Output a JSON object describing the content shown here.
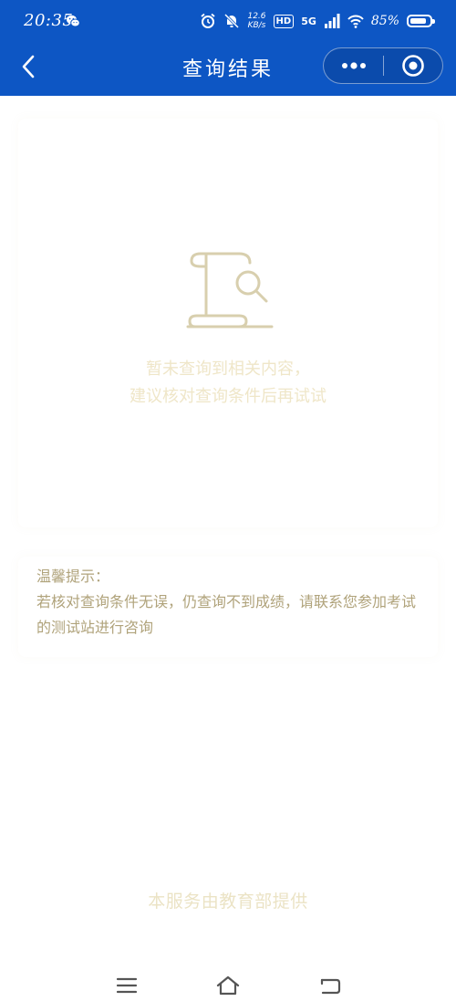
{
  "status_bar": {
    "time": "20:35",
    "net_speed_value": "12.6",
    "net_speed_unit": "KB/s",
    "hd_label": "HD",
    "network_label": "5G",
    "battery_text": "85%",
    "battery_level": 0.85
  },
  "nav": {
    "title": "查询结果"
  },
  "result": {
    "empty_line1": "暂未查询到相关内容，",
    "empty_line2": "建议核对查询条件后再试试"
  },
  "tips": {
    "title": "温馨提示：",
    "body": "若核对查询条件无误，仍查询不到成绩，请联系您参加考试的测试站进行咨询"
  },
  "footer": {
    "provider": "本服务由教育部提供"
  },
  "colors": {
    "header_blue": "#0d56c4",
    "illustration": "#d8cfae",
    "empty_text": "#efe6c8",
    "tips_text": "#b0a37b",
    "footer_text": "#ebe3c5"
  },
  "icons": {
    "back": "chevron-left-icon",
    "more": "more-dots-icon",
    "close": "target-close-icon",
    "empty": "document-search-icon",
    "menu": "menu-icon",
    "home": "home-icon",
    "back_sys": "back-arrow-icon"
  }
}
